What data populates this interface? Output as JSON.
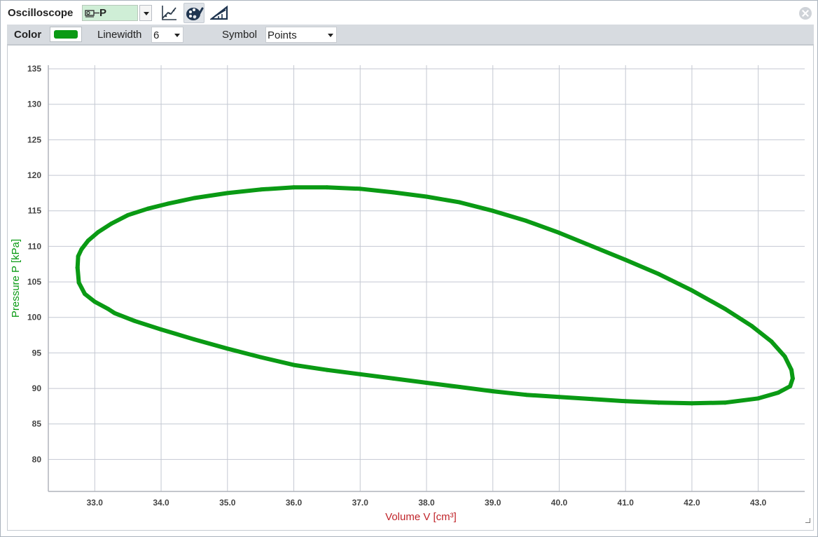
{
  "window": {
    "title": "Oscilloscope",
    "channel": {
      "label": "P",
      "icon": "sensor-channel-icon",
      "bg_color": "#cfeed6"
    },
    "tools": [
      {
        "name": "xy-diagram-tool",
        "icon": "line-graph-icon",
        "active": false
      },
      {
        "name": "display-options-tool",
        "icon": "palette-brush-icon",
        "active": true
      },
      {
        "name": "scale-tool",
        "icon": "ruler-triangle-icon",
        "active": false
      }
    ],
    "close_icon": "close-icon"
  },
  "options": {
    "color_label": "Color",
    "color_value": "#0a9a14",
    "linewidth_label": "Linewidth",
    "linewidth_value": "6",
    "symbol_label": "Symbol",
    "symbol_value": "Points"
  },
  "chart_data": {
    "type": "scatter",
    "series": [
      {
        "color": "#0a9a14",
        "x": [
          32.74,
          32.75,
          32.8,
          32.9,
          33.05,
          33.25,
          33.5,
          33.8,
          34.1,
          34.5,
          35.0,
          35.5,
          36.0,
          36.5,
          37.0,
          37.5,
          38.0,
          38.5,
          39.0,
          39.5,
          40.0,
          40.5,
          41.0,
          41.5,
          42.0,
          42.5,
          42.9,
          43.2,
          43.4,
          43.5,
          43.52,
          43.48,
          43.3,
          43.0,
          42.5,
          42.0,
          41.5,
          41.0,
          40.5,
          40.0,
          39.5,
          39.0,
          38.5,
          38.0,
          37.5,
          37.0,
          36.5,
          36.0,
          35.5,
          35.0,
          34.5,
          34.0,
          33.6,
          33.3,
          33.2,
          33.0,
          32.85,
          32.76,
          32.74
        ],
        "y": [
          107.0,
          108.6,
          109.6,
          110.8,
          112.0,
          113.2,
          114.4,
          115.3,
          116.0,
          116.8,
          117.5,
          118.0,
          118.3,
          118.3,
          118.1,
          117.6,
          117.0,
          116.2,
          115.0,
          113.6,
          111.9,
          110.0,
          108.1,
          106.1,
          103.8,
          101.2,
          98.8,
          96.6,
          94.5,
          92.6,
          91.4,
          90.3,
          89.4,
          88.6,
          88.0,
          87.9,
          88.0,
          88.2,
          88.5,
          88.8,
          89.1,
          89.6,
          90.2,
          90.8,
          91.4,
          92.0,
          92.6,
          93.3,
          94.4,
          95.6,
          96.9,
          98.3,
          99.5,
          100.6,
          101.2,
          102.2,
          103.3,
          104.9,
          107.0
        ]
      }
    ],
    "xlabel": "Volume V [cm³]",
    "ylabel": "Pressure P [kPa]",
    "xlim": [
      32.3,
      43.7
    ],
    "ylim": [
      75.5,
      135.5
    ],
    "x_ticks": [
      "33.0",
      "34.0",
      "35.0",
      "36.0",
      "37.0",
      "38.0",
      "39.0",
      "40.0",
      "41.0",
      "42.0",
      "43.0"
    ],
    "y_ticks": [
      "80",
      "85",
      "90",
      "95",
      "100",
      "105",
      "110",
      "115",
      "120",
      "125",
      "130",
      "135"
    ],
    "grid": true,
    "xlabel_color": "#c0242a",
    "ylabel_color": "#0a9a14"
  }
}
